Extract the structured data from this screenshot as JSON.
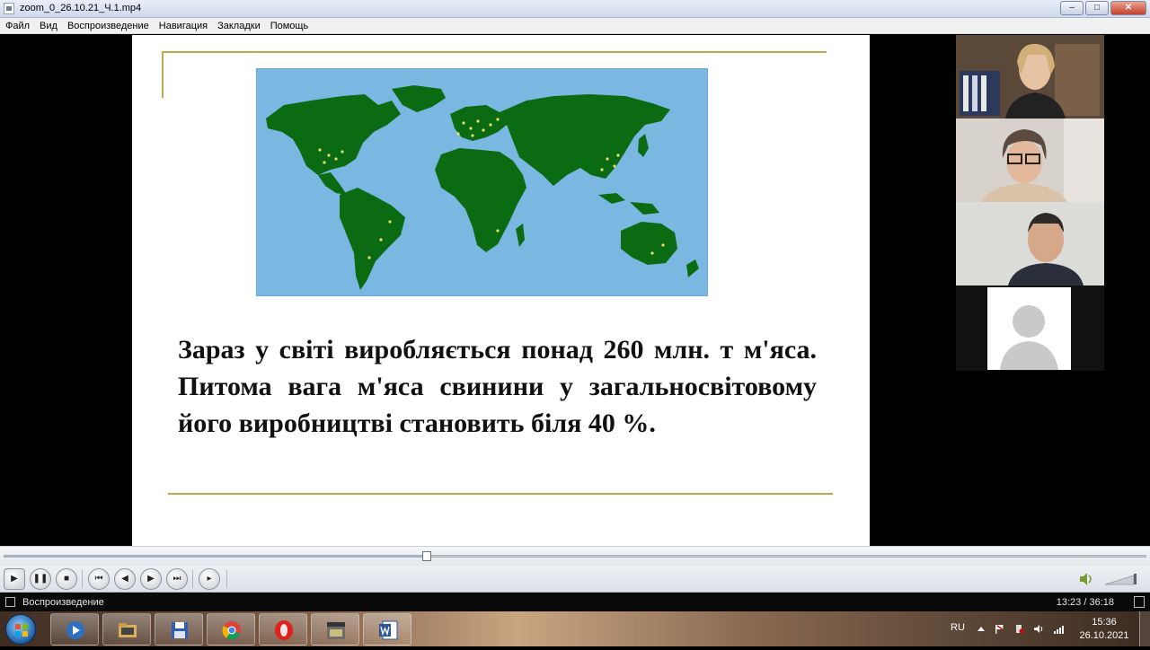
{
  "window": {
    "title": "zoom_0_26.10.21_Ч.1.mp4",
    "minimize_label": "–",
    "maximize_label": "□",
    "close_label": "✕"
  },
  "menu": {
    "items": [
      "Файл",
      "Вид",
      "Воспроизведение",
      "Навигация",
      "Закладки",
      "Помощь"
    ]
  },
  "slide": {
    "text": "Зараз у світі виробляється понад 260 млн. т м'яса. Питома вага м'яса свинини у загальносвітовому його виробництві становить біля 40 %.",
    "map_colors": {
      "ocean": "#7ab8e2",
      "land": "#0b6b12",
      "dots": "#e8e06a"
    }
  },
  "participants": [
    {
      "name": "participant-1",
      "kind": "video"
    },
    {
      "name": "participant-2",
      "kind": "video"
    },
    {
      "name": "participant-3",
      "kind": "video"
    },
    {
      "name": "participant-4",
      "kind": "avatar-placeholder"
    }
  ],
  "player": {
    "progress": 0.37,
    "volume": 1.0,
    "buttons": [
      "play-icon",
      "pause-icon",
      "stop-icon",
      "skip-previous-icon",
      "rewind-icon",
      "fast-forward-icon",
      "skip-next-icon",
      "frame-step-icon"
    ]
  },
  "status": {
    "state": "Воспроизведение",
    "time": "13:23 / 36:18"
  },
  "taskbar": {
    "apps": [
      "start-orb",
      "media-player",
      "file-explorer",
      "save-app",
      "chrome",
      "opera",
      "video-editor",
      "word"
    ],
    "tray": {
      "lang": "RU"
    },
    "clock": {
      "time": "15:36",
      "date": "26.10.2021"
    }
  }
}
